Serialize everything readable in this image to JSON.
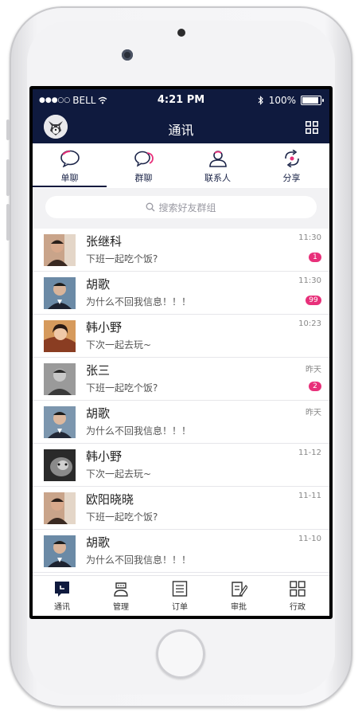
{
  "status_bar": {
    "carrier": "BELL",
    "time": "4:21 PM",
    "battery": "100%",
    "battery_level": 1.0
  },
  "header": {
    "title": "通讯",
    "menu_icon": "grid-icon",
    "avatar_icon": "dog-avatar"
  },
  "tabs": [
    {
      "label": "单聊",
      "icon": "chat-bubble-icon",
      "active": true
    },
    {
      "label": "群聊",
      "icon": "group-chat-icon",
      "active": false
    },
    {
      "label": "联系人",
      "icon": "contact-icon",
      "active": false
    },
    {
      "label": "分享",
      "icon": "share-icon",
      "active": false
    }
  ],
  "search": {
    "placeholder": "搜索好友群组"
  },
  "conversations": [
    {
      "name": "张继科",
      "message": "下班一起吃个饭?",
      "time": "11:30",
      "badge": "1"
    },
    {
      "name": "胡歌",
      "message": "为什么不回我信息！！！",
      "time": "11:30",
      "badge": "99"
    },
    {
      "name": "韩小野",
      "message": "下次一起去玩~",
      "time": "10:23",
      "badge": ""
    },
    {
      "name": "张三",
      "message": "下班一起吃个饭?",
      "time": "昨天",
      "badge": "2"
    },
    {
      "name": "胡歌",
      "message": "为什么不回我信息！！！",
      "time": "昨天",
      "badge": ""
    },
    {
      "name": "韩小野",
      "message": "下次一起去玩~",
      "time": "11-12",
      "badge": ""
    },
    {
      "name": "欧阳晓晓",
      "message": "下班一起吃个饭?",
      "time": "11-11",
      "badge": ""
    },
    {
      "name": "胡歌",
      "message": "为什么不回我信息！！！",
      "time": "11-10",
      "badge": ""
    }
  ],
  "bottom_nav": [
    {
      "label": "通讯",
      "icon": "chat-icon",
      "active": true
    },
    {
      "label": "管理",
      "icon": "manager-icon",
      "active": false
    },
    {
      "label": "订单",
      "icon": "order-list-icon",
      "active": false
    },
    {
      "label": "审批",
      "icon": "approval-icon",
      "active": false
    },
    {
      "label": "行政",
      "icon": "apps-grid-icon",
      "active": false
    }
  ],
  "colors": {
    "header_bg": "#0f1a3e",
    "badge": "#e8307a",
    "tab_icon": "#1b2448",
    "accent_pink": "#e8307a"
  }
}
